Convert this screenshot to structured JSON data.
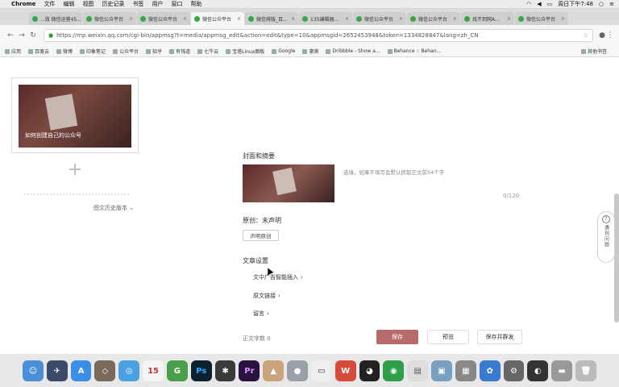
{
  "menubar": {
    "app": "Chrome",
    "items": [
      "文件",
      "编辑",
      "视图",
      "历史记录",
      "书签",
      "用户",
      "窗口",
      "帮助"
    ],
    "clock": "周日下午7:48"
  },
  "tabs": [
    {
      "label": "...效 微信运营45..."
    },
    {
      "label": "微信公众平台"
    },
    {
      "label": "微信公众平台"
    },
    {
      "label": "微信公众平台"
    },
    {
      "label": "微信排版_百..."
    },
    {
      "label": "135编辑器..."
    },
    {
      "label": "微信公众平台"
    },
    {
      "label": "微信公众平台"
    },
    {
      "label": "找不到网A..."
    },
    {
      "label": "微信公众平台"
    }
  ],
  "toolbar": {
    "url": "https://mp.weixin.qq.com/cgi-bin/appmsg?t=media/appmsg_edit&action=edit&type=10&appmsgid=2652453948&token=1334828847&lang=zh_CN"
  },
  "bookmarks": {
    "items": [
      "应用",
      "百度云",
      "微博",
      "印象笔记",
      "公众平台",
      "知乎",
      "有钱道",
      "七牛云",
      "宝塔Linux面板",
      "Google",
      "豪爽",
      "Dribbble - Show a...",
      "Behance :: Behan..."
    ],
    "other": "其他书签"
  },
  "left_panel": {
    "thumb_caption": "如何创建自己的公众号",
    "history": "图文历史版本"
  },
  "editor": {
    "cover_title": "封面和摘要",
    "summary_hint": "选填，如果不填写会默认抓取正文前54个字",
    "counter": "0/120",
    "original_label": "原创：",
    "original_value": "未声明",
    "declare_button": "声明原创",
    "settings_title": "文章设置",
    "setting_ad": "文中广告智能插入",
    "setting_link": "原文链接",
    "setting_comment": "留言",
    "wordcount": "正文字数 0",
    "save": "保存",
    "preview": "预览",
    "publish": "保存并群发"
  },
  "help_float": {
    "text": "遇到问题"
  }
}
